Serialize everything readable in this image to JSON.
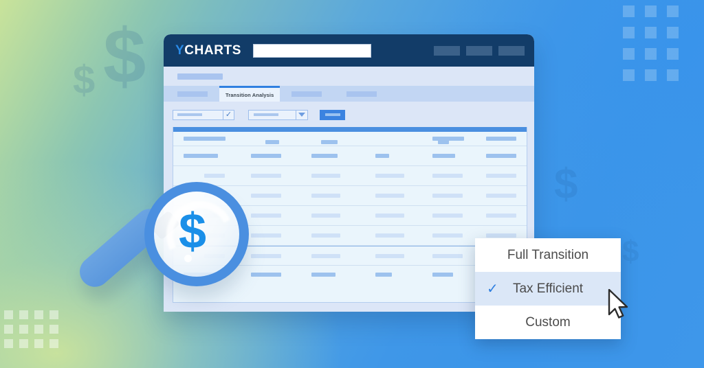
{
  "app": {
    "logo_y": "Y",
    "logo_rest": "CHARTS",
    "search_placeholder": "",
    "search_value": ""
  },
  "tabs": {
    "active_label": "Transition Analysis"
  },
  "dropdown": {
    "items": [
      {
        "label": "Full Transition",
        "selected": false
      },
      {
        "label": "Tax Efficient",
        "selected": true
      },
      {
        "label": "Custom",
        "selected": false
      }
    ],
    "check_glyph": "✓"
  },
  "toolbar": {
    "check_glyph": "✓"
  },
  "decor": {
    "dollar_glyph": "$",
    "lens_dollar": "$"
  },
  "colors": {
    "brand_navy": "#123c68",
    "brand_blue": "#2f7fe0",
    "accent_blue": "#4a8fe0",
    "lens_dollar": "#1a8fe8",
    "table_bg": "#eaf5fc",
    "panel_bg": "#dce6f7",
    "menu_selected_bg": "#dbe7f7"
  }
}
